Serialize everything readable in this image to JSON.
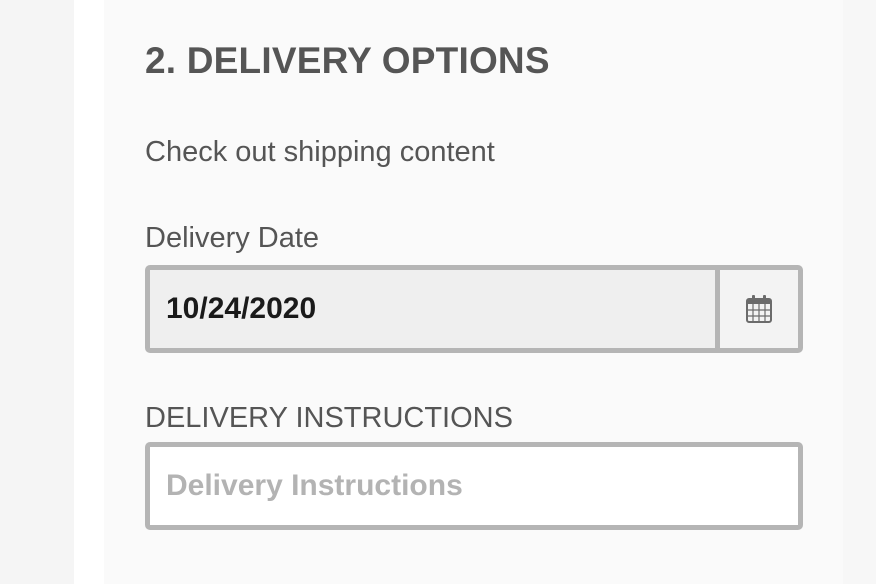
{
  "section": {
    "title": "2. DELIVERY OPTIONS",
    "subtitle": "Check out shipping content"
  },
  "delivery_date": {
    "label": "Delivery Date",
    "value": "10/24/2020",
    "icon": "calendar-icon"
  },
  "delivery_instructions": {
    "label": "DELIVERY INSTRUCTIONS",
    "value": "",
    "placeholder": "Delivery Instructions"
  },
  "colors": {
    "text": "#555555",
    "border": "#b5b5b5",
    "field_bg": "#efefef",
    "panel_bg": "#fafafa"
  }
}
